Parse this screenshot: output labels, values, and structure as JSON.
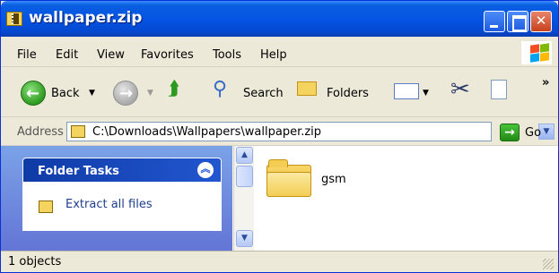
{
  "window": {
    "title": "wallpaper.zip"
  },
  "menu": {
    "items": [
      {
        "label": "File",
        "underline": "F"
      },
      {
        "label": "Edit",
        "underline": "E"
      },
      {
        "label": "View",
        "underline": "V"
      },
      {
        "label": "Favorites",
        "underline": "a"
      },
      {
        "label": "Tools",
        "underline": "T"
      },
      {
        "label": "Help",
        "underline": "H"
      }
    ]
  },
  "toolbar": {
    "back_label": "Back",
    "search_label": "Search",
    "folders_label": "Folders",
    "chevron": "»"
  },
  "address": {
    "label": "Address",
    "path": "C:\\Downloads\\Wallpapers\\wallpaper.zip",
    "go_label": "Go"
  },
  "tasks": {
    "title": "Folder Tasks",
    "items": [
      "Extract all files"
    ]
  },
  "content": {
    "items": [
      {
        "name": "gsm",
        "icon": "folder-icon"
      }
    ]
  },
  "status": {
    "text": "1 objects"
  },
  "colors": {
    "titlebar": "#0554E3",
    "task_header": "#2256D0",
    "link": "#1F3E8C"
  }
}
